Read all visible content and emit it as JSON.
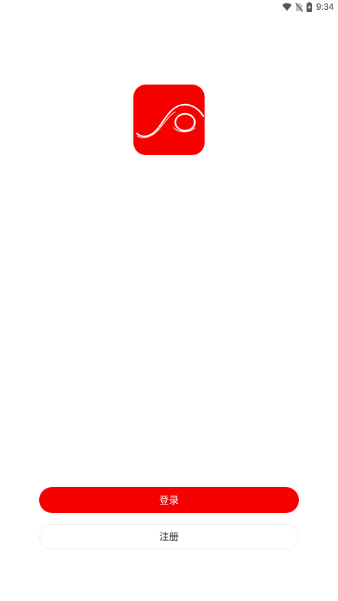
{
  "status_bar": {
    "time": "9:34",
    "icons": [
      "wifi-icon",
      "no-sim-icon",
      "battery-charging-icon"
    ]
  },
  "logo": {
    "icon": "app-logo-icon",
    "background_color": "#f70000",
    "mark_color": "#ffffff"
  },
  "buttons": {
    "login_label": "登录",
    "register_label": "注册"
  },
  "colors": {
    "accent": "#f70000",
    "register_background": "#ffffff",
    "register_border": "#f0f0f0"
  }
}
